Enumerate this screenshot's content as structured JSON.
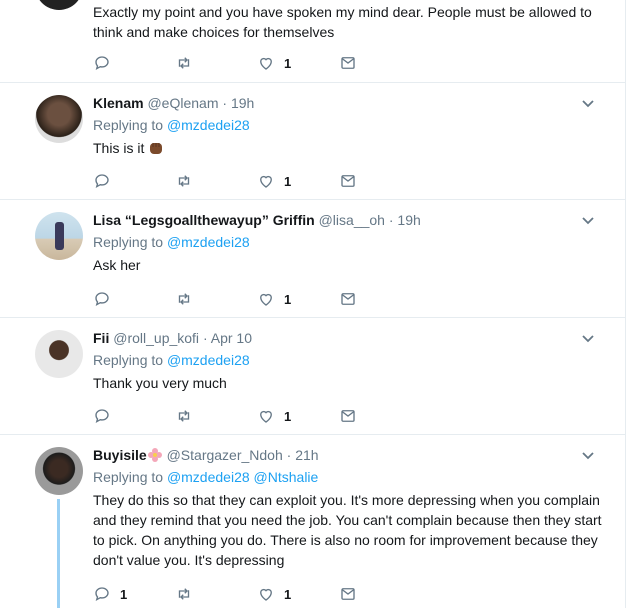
{
  "tweets": [
    {
      "text": "Exactly my point and you have spoken my mind dear. People must be allowed to think and make choices for themselves",
      "likes": "1"
    },
    {
      "name": "Klenam",
      "handle": "@eQlenam",
      "dot": "·",
      "time": "19h",
      "replying_prefix": "Replying to",
      "mentions": [
        "@mzdedei28"
      ],
      "text": "This is it",
      "emoji": "fist-emoji",
      "likes": "1"
    },
    {
      "name": "Lisa “Legsgoallthewayup” Griffin",
      "handle": "@lisa__oh",
      "dot": "·",
      "time": "19h",
      "replying_prefix": "Replying to",
      "mentions": [
        "@mzdedei28"
      ],
      "text": "Ask her",
      "likes": "1"
    },
    {
      "name": "Fii",
      "handle": "@roll_up_kofi",
      "dot": "·",
      "time": "Apr 10",
      "replying_prefix": "Replying to",
      "mentions": [
        "@mzdedei28"
      ],
      "text": "Thank you very much",
      "likes": "1"
    },
    {
      "name": "Buyisile",
      "name_emoji": "flower-emoji",
      "handle": "@Stargazer_Ndoh",
      "dot": "·",
      "time": "21h",
      "replying_prefix": "Replying to",
      "mentions": [
        "@mzdedei28",
        "@Ntshalie"
      ],
      "text": "They do this so that they can exploit you. It's more depressing when you complain and they remind that you need the job. You can't complain because then they start to pick. On anything you do. There is also no room for improvement because they don't value you. It's depressing",
      "replies": "1",
      "likes": "1"
    }
  ],
  "colors": {
    "link": "#1da1f2",
    "muted": "#657786",
    "thread": "#9ad0f4"
  }
}
